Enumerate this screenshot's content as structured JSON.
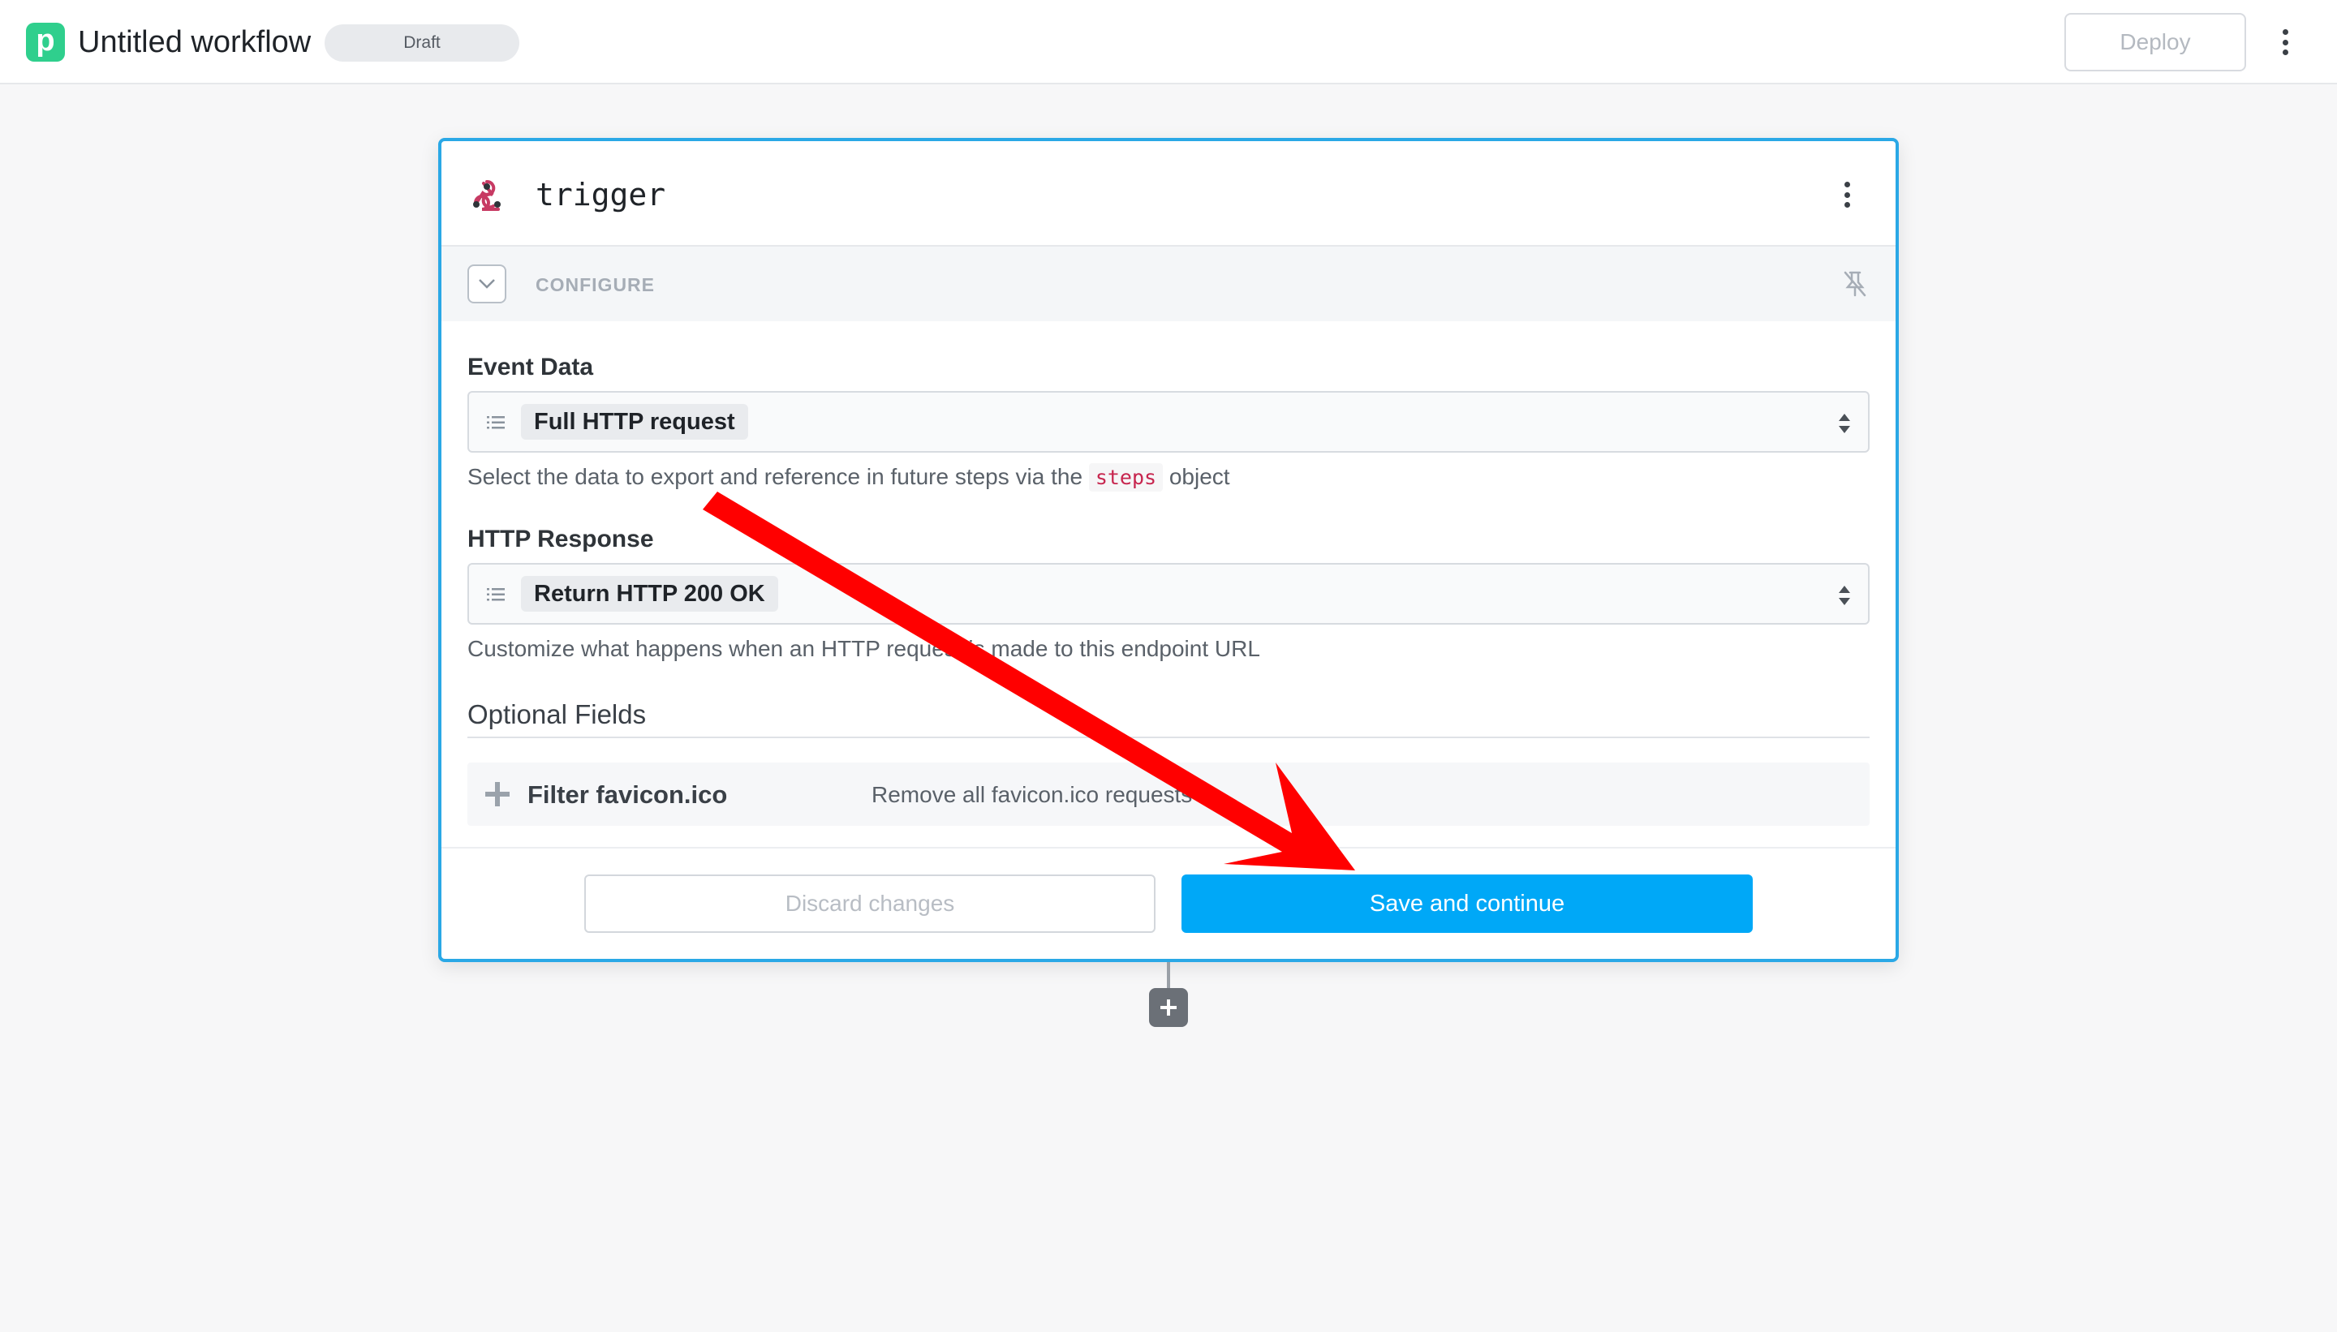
{
  "header": {
    "logo_letter": "p",
    "title": "Untitled workflow",
    "status_badge": "Draft",
    "deploy_label": "Deploy"
  },
  "step": {
    "title": "trigger",
    "configure_label": "CONFIGURE",
    "fields": [
      {
        "label": "Event Data",
        "selected": "Full HTTP request",
        "help_before": "Select the data to export and reference in future steps via the",
        "help_code": "steps",
        "help_after": "object"
      },
      {
        "label": "HTTP Response",
        "selected": "Return HTTP 200 OK",
        "help": "Customize what happens when an HTTP request is made to this endpoint URL"
      }
    ],
    "optional": {
      "title": "Optional Fields",
      "items": [
        {
          "name": "Filter favicon.ico",
          "description": "Remove all favicon.ico requests"
        }
      ]
    },
    "discard_label": "Discard changes",
    "save_label": "Save and continue"
  },
  "colors": {
    "brand": "#2fcf8d",
    "accent": "#00a8f7",
    "card_border": "#2aa8e6",
    "annotation_arrow": "#ff0000"
  },
  "icons": [
    "webhook-icon",
    "kebab-menu-icon",
    "chevron-down-icon",
    "pin-off-icon",
    "list-icon",
    "sort-updown-icon",
    "plus-icon"
  ]
}
